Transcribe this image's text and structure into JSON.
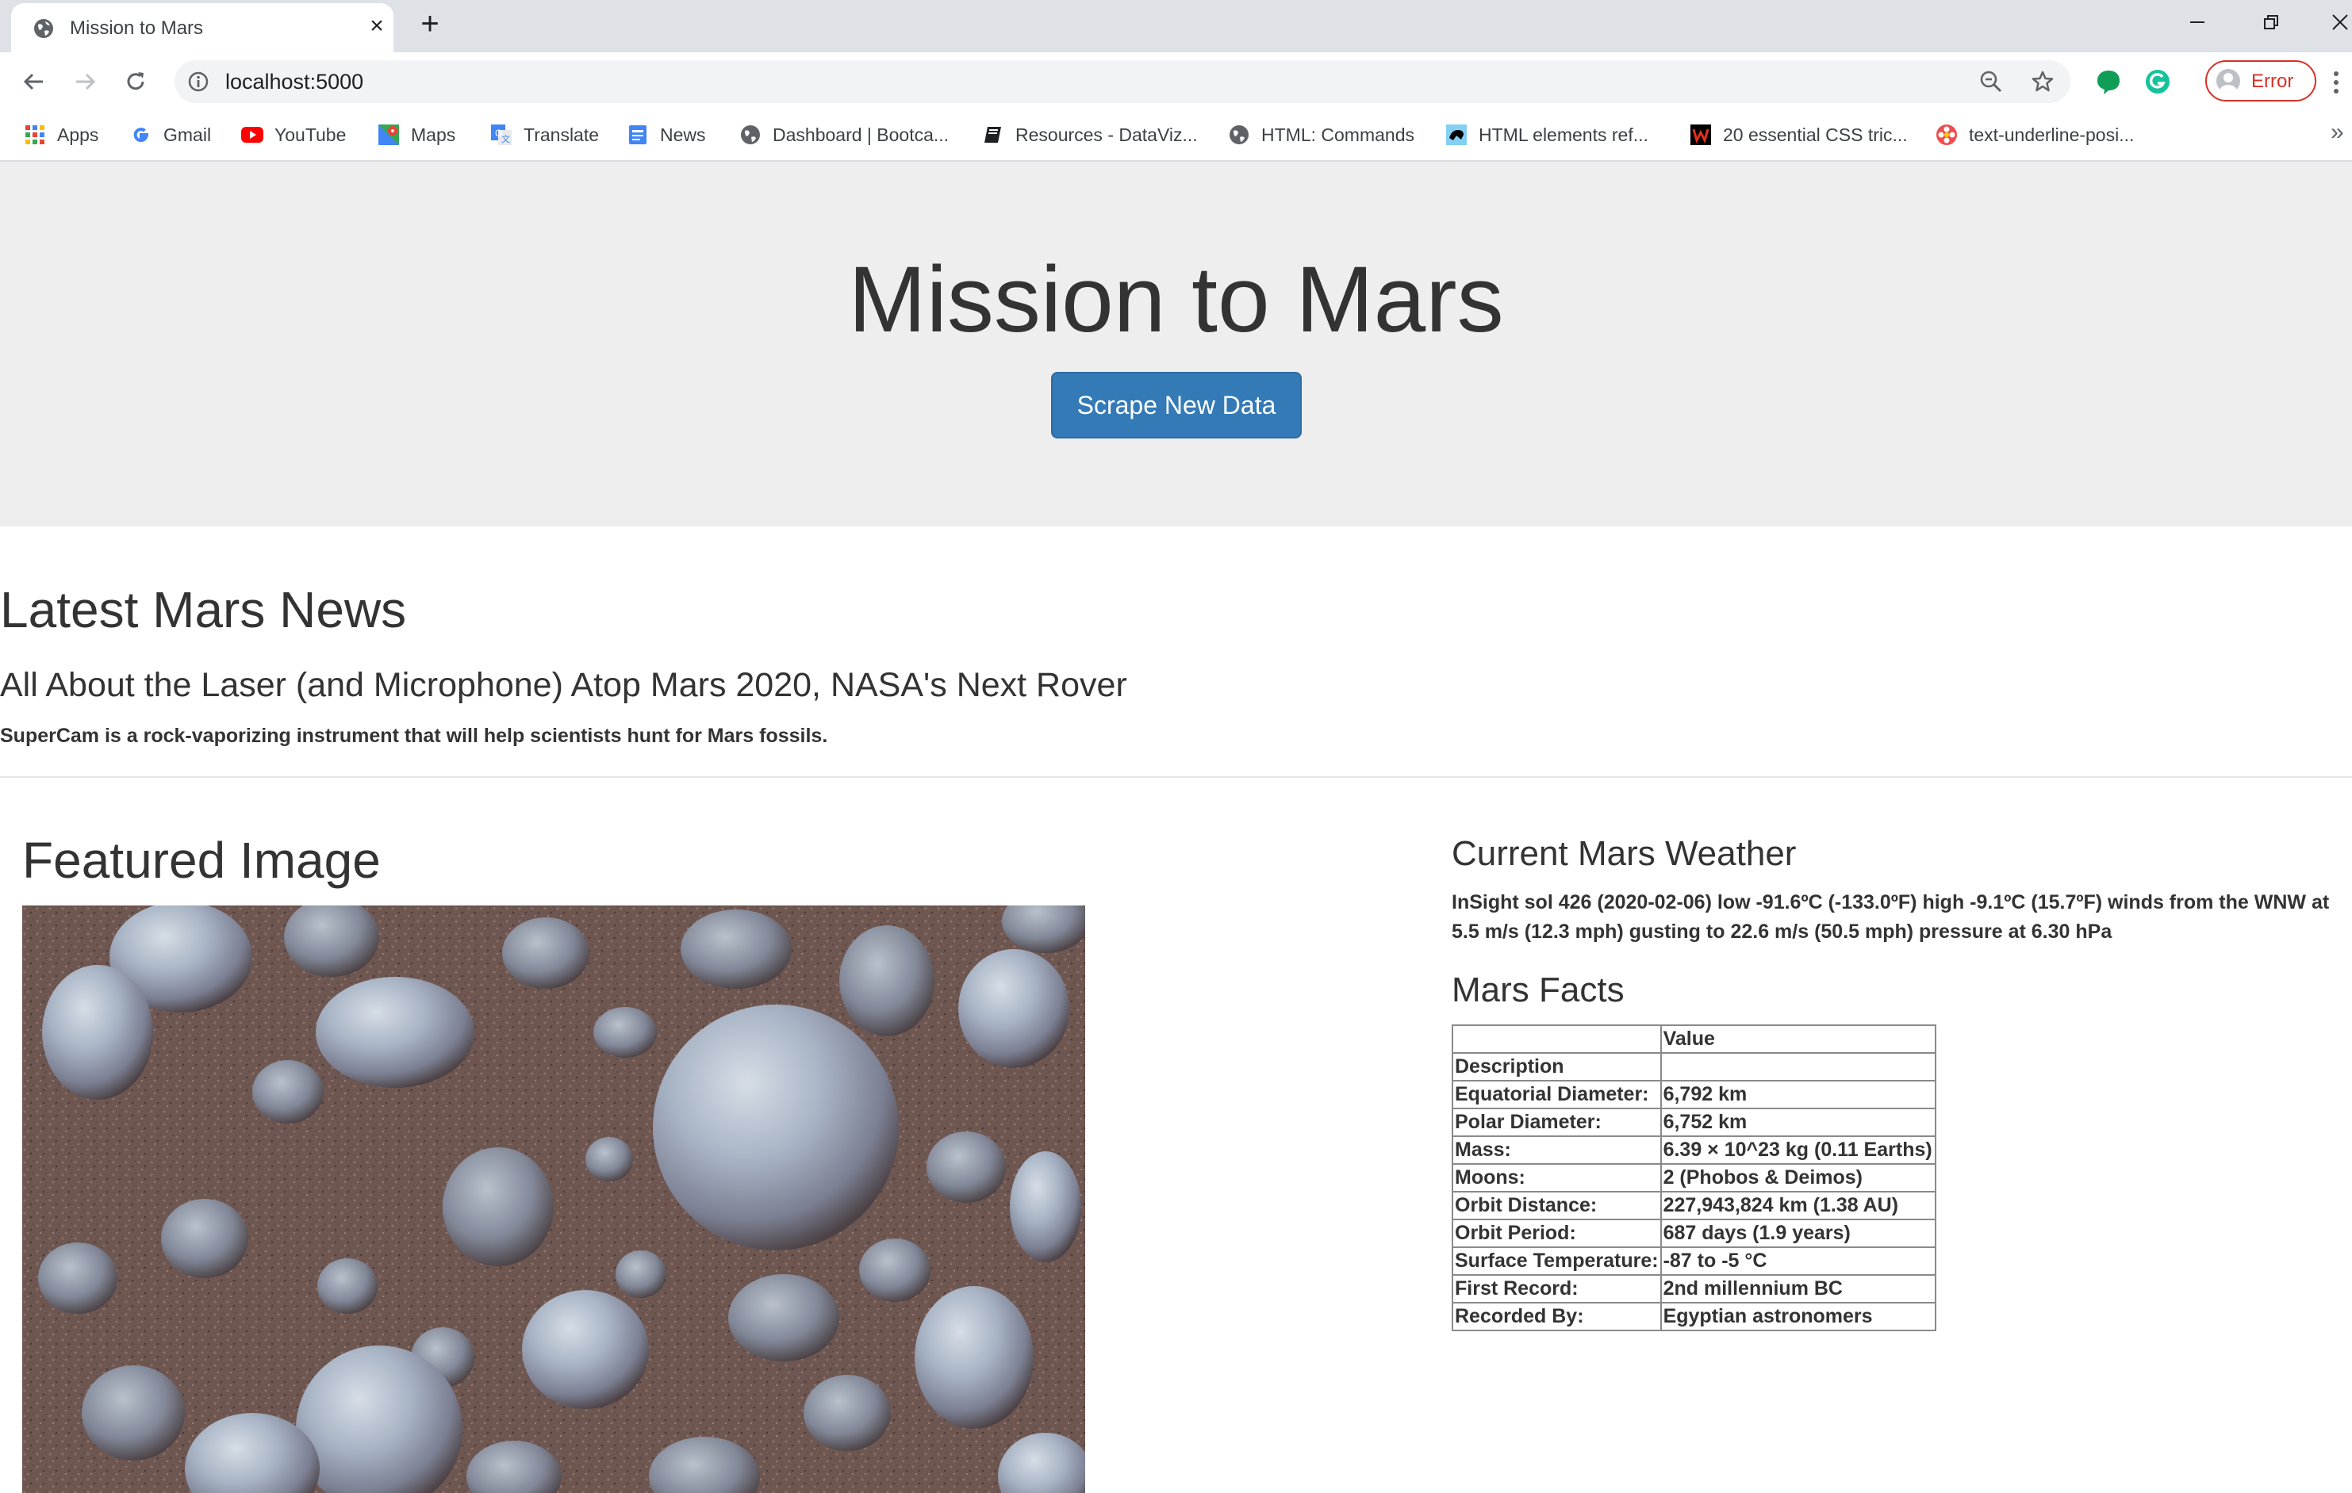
{
  "browser": {
    "tab_title": "Mission to Mars",
    "url": "localhost:5000",
    "profile_label": "Error",
    "bookmarks": [
      {
        "label": "Apps",
        "icon": "apps-grid-icon"
      },
      {
        "label": "Gmail",
        "icon": "google-icon"
      },
      {
        "label": "YouTube",
        "icon": "youtube-icon"
      },
      {
        "label": "Maps",
        "icon": "maps-icon"
      },
      {
        "label": "Translate",
        "icon": "translate-icon"
      },
      {
        "label": "News",
        "icon": "news-icon"
      },
      {
        "label": "Dashboard | Bootca...",
        "icon": "globe-icon"
      },
      {
        "label": "Resources - DataViz...",
        "icon": "book-icon"
      },
      {
        "label": "HTML: Commands",
        "icon": "globe-icon"
      },
      {
        "label": "HTML elements ref...",
        "icon": "mdn-icon"
      },
      {
        "label": "20 essential CSS tric...",
        "icon": "w-logo-icon"
      },
      {
        "label": "text-underline-posi...",
        "icon": "flower-icon"
      }
    ]
  },
  "jumbotron": {
    "title": "Mission to Mars",
    "button_label": "Scrape New Data"
  },
  "news": {
    "heading": "Latest Mars News",
    "title": "All About the Laser (and Microphone) Atop Mars 2020, NASA's Next Rover",
    "teaser": "SuperCam is a rock-vaporizing instrument that will help scientists hunt for Mars fossils."
  },
  "featured": {
    "heading": "Featured Image"
  },
  "weather": {
    "heading": "Current Mars Weather",
    "text": "InSight sol 426 (2020-02-06) low -91.6ºC (-133.0ºF) high -9.1ºC (15.7ºF) winds from the WNW at 5.5 m/s (12.3 mph) gusting to 22.6 m/s (50.5 mph) pressure at 6.30 hPa"
  },
  "facts": {
    "heading": "Mars Facts",
    "header_value": "Value",
    "index_label": "Description",
    "rows": [
      {
        "label": "Equatorial Diameter:",
        "value": "6,792 km"
      },
      {
        "label": "Polar Diameter:",
        "value": "6,752 km"
      },
      {
        "label": "Mass:",
        "value": "6.39 × 10^23 kg (0.11 Earths)"
      },
      {
        "label": "Moons:",
        "value": "2 (Phobos & Deimos)"
      },
      {
        "label": "Orbit Distance:",
        "value": "227,943,824 km (1.38 AU)"
      },
      {
        "label": "Orbit Period:",
        "value": "687 days (1.9 years)"
      },
      {
        "label": "Surface Temperature:",
        "value": "-87 to -5 °C"
      },
      {
        "label": "First Record:",
        "value": "2nd millennium BC"
      },
      {
        "label": "Recorded By:",
        "value": "Egyptian astronomers"
      }
    ]
  }
}
